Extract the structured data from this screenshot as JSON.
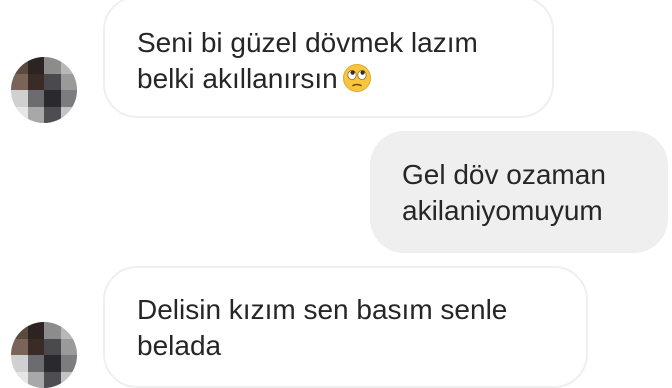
{
  "conversation": {
    "messages": [
      {
        "direction": "incoming",
        "lines": [
          "Seni bi güzel dövmek lazım",
          "belki akıllanırsın"
        ],
        "emoji": "face-with-rolling-eyes-icon"
      },
      {
        "direction": "outgoing",
        "lines": [
          "Gel döv ozaman",
          "akilaniyomuyum"
        ]
      },
      {
        "direction": "incoming",
        "lines": [
          "Delisin kızım sen basım senle",
          "belada"
        ]
      }
    ]
  },
  "colors": {
    "incoming_bubble_bg": "#ffffff",
    "incoming_bubble_border": "#efefef",
    "outgoing_bubble_bg": "#efefef",
    "text": "#262626",
    "emoji_face": "#f7c640"
  }
}
